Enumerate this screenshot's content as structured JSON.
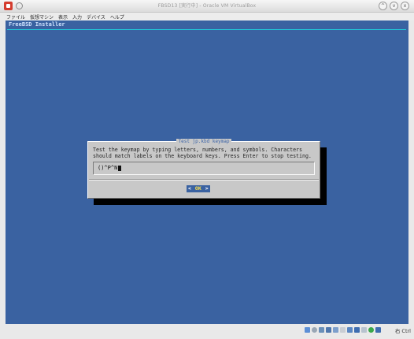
{
  "window": {
    "title": "FBSD13 [実行中] - Oracle VM VirtualBox",
    "buttons": [
      "^",
      "v",
      "x"
    ]
  },
  "menu": {
    "items": [
      "ファイル",
      "仮想マシン",
      "表示",
      "入力",
      "デバイス",
      "ヘルプ"
    ]
  },
  "guest": {
    "header_title": "FreeBSD Installer",
    "dialog": {
      "title": "Test jp.kbd keymap",
      "message": "Test the keymap by typing letters, numbers, and symbols. Characters should match labels on the keyboard keys. Press Enter to stop testing.",
      "input_value": "()^P^N",
      "ok_label": "OK",
      "ok_left_arrow": "<",
      "ok_right_arrow": ">"
    }
  },
  "status": {
    "host_key": "右 Ctrl",
    "tray_icons": [
      "hdd-icon",
      "cd-icon",
      "network-icon",
      "usb-icon",
      "shared-folder-icon",
      "display-icon",
      "record-icon",
      "cpu-icon",
      "mouse-icon",
      "green-status-icon",
      "arrow-icon"
    ]
  },
  "colors": {
    "guest_background": "#3a62a1",
    "dialog_background": "#c8c8c8",
    "accent_line": "#22c3d6",
    "ok_text": "#ffe14d"
  }
}
